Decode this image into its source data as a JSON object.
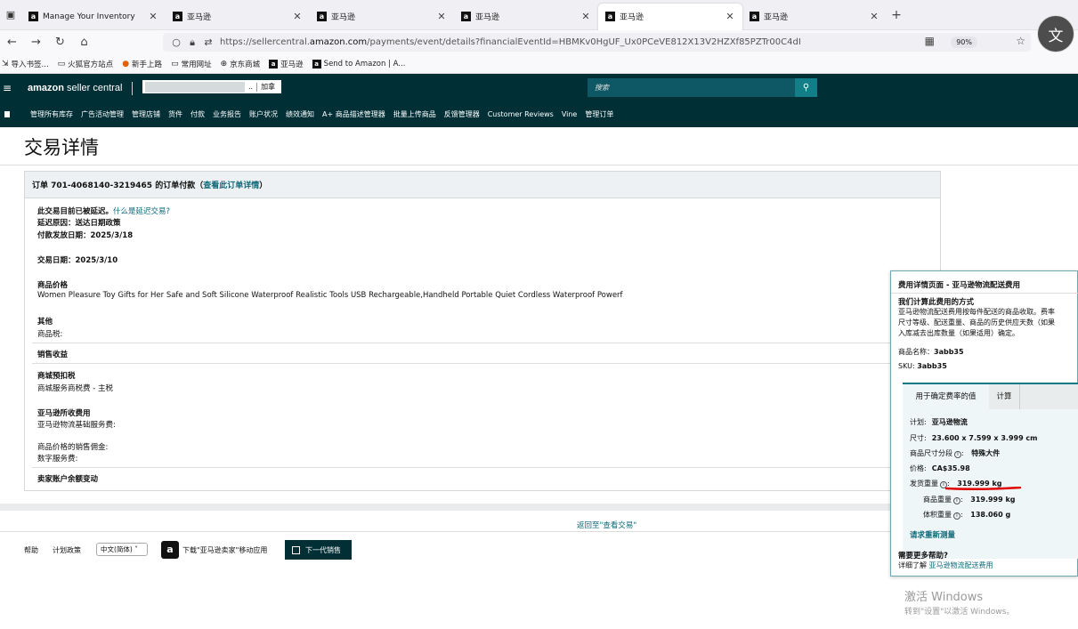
{
  "browser": {
    "tabs": [
      {
        "label": "Manage Your Inventory",
        "active": false
      },
      {
        "label": "亚马逊",
        "active": false
      },
      {
        "label": "亚马逊",
        "active": false
      },
      {
        "label": "亚马逊",
        "active": false
      },
      {
        "label": "亚马逊",
        "active": true
      },
      {
        "label": "亚马逊",
        "active": false
      }
    ],
    "url_prefix": "https://sellercentral.",
    "url_domain": "amazon.com",
    "url_rest": "/payments/event/details?financialEventId=HBMKv0HgUF_Ux0PCeVE812X13V2HZXf85PZTr00C4dI",
    "zoom": "90%",
    "bookmarks": [
      "导入书签...",
      "火狐官方站点",
      "新手上路",
      "常用网址",
      "京东商城",
      "亚马逊",
      "Send to Amazon | A..."
    ]
  },
  "header": {
    "logo_bold": "amazon",
    "logo_rest": " seller central",
    "account_tail": "..",
    "join": "加拿",
    "search_placeholder": "搜索"
  },
  "nav": [
    "管理所有库存",
    "广告活动管理",
    "管理店铺",
    "货件",
    "付款",
    "业务报告",
    "账户状况",
    "绩效通知",
    "A+ 商品描述管理器",
    "批量上传商品",
    "反馈管理器",
    "Customer Reviews",
    "Vine",
    "管理订单"
  ],
  "page": {
    "title": "交易详情",
    "order_heading": "订单 701-4068140-3219465 的订单付款（",
    "order_link": "查看此订单详情",
    "order_heading_end": "）",
    "deferred": "此交易目前已被延迟。",
    "deferred_link": "什么是延迟交易?",
    "reason": "延迟原因：送达日期政策",
    "pay_date": "付款发放日期：2025/3/18",
    "tx_date": "交易日期：2025/3/10",
    "price_label": "商品价格",
    "product_title": "Women Pleasure Toy Gifts for Her Safe and Soft Silicone Waterproof Realistic Tools USB Rechargeable,Handheld Portable Quiet Cordless Waterproof Powerf",
    "other_label": "其他",
    "tax_label": "商品税:",
    "sales_income": "销售收益",
    "withheld_label": "商城预扣税",
    "withheld_item": "商城服务商税费 - 主税",
    "fees_label": "亚马逊所收费用",
    "fba_fee": "亚马逊物流基础服务费:",
    "commission": "商品价格的销售佣金:",
    "digital_fee": "数字服务费:",
    "balance": "卖家账户余额变动"
  },
  "footer": {
    "back_link": "返回至\"查看交易\"",
    "help": "帮助",
    "policy": "计划政策",
    "language": "中文(简体)",
    "app_download": "下载\"亚马逊卖家\"移动应用",
    "next_gen": "下一代销售"
  },
  "popover": {
    "title": "费用详情页面 - 亚马逊物流配送费用",
    "subtitle": "我们计算此费用的方式",
    "desc_lines": [
      "亚马逊物流配送费用按每件配送的商品收取。费率",
      "尺寸等级、配送重量、商品的历史供应天数（如果",
      "入库减去出库数量（如果适用）确定。"
    ],
    "product_name_k": "商品名称：",
    "product_name_v": "3abb35",
    "sku_k": "SKU:",
    "sku_v": "3abb35",
    "tab1": "用于确定费率的值",
    "tab2": "计算",
    "plan_k": "计划:",
    "plan_v": "亚马逊物流",
    "dims_k": "尺寸:",
    "dims_v": "23.600 x 7.599 x 3.999 cm",
    "tier_k": "商品尺寸分段",
    "tier_v": "特殊大件",
    "price_k": "价格:",
    "price_v": "CA$35.98",
    "ship_weight_k": "发货重量",
    "ship_weight_v": "319.999 kg",
    "unit_weight_k": "商品重量",
    "unit_weight_v": "319.999 kg",
    "dim_weight_k": "体积重量",
    "dim_weight_v": "138.060 g",
    "remeasure": "请求重新测量",
    "help_title": "需要更多帮助?",
    "help_text": "详细了解 ",
    "help_link": "亚马逊物流配送费用"
  },
  "watermark": {
    "line1": "激活 Windows",
    "line2": "转到\"设置\"以激活 Windows。"
  },
  "colors": {
    "amazon_header": "#002f36",
    "link": "#0e6978",
    "annotation": "#e00000"
  }
}
